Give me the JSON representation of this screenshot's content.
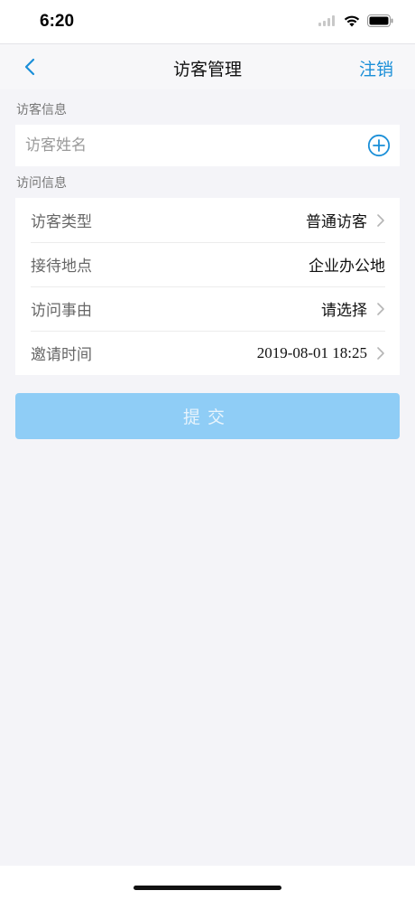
{
  "status_bar": {
    "time": "6:20"
  },
  "nav": {
    "title": "访客管理",
    "logout_label": "注销",
    "accent_color": "#1a8fd8"
  },
  "visitor_section": {
    "label": "访客信息",
    "name_placeholder": "访客姓名",
    "name_value": ""
  },
  "visit_section": {
    "label": "访问信息",
    "rows": [
      {
        "label": "访客类型",
        "value": "普通访客",
        "has_chevron": true
      },
      {
        "label": "接待地点",
        "value": "企业办公地",
        "has_chevron": false
      },
      {
        "label": "访问事由",
        "value": "请选择",
        "has_chevron": true
      },
      {
        "label": "邀请时间",
        "value": "2019-08-01 18:25",
        "has_chevron": true
      }
    ]
  },
  "submit": {
    "label": "提交",
    "color": "#8fcdf6"
  },
  "icons": {
    "back": "chevron-left-icon",
    "add": "plus-circle-icon",
    "row_arrow": "chevron-right-icon",
    "signal": "signal-icon",
    "wifi": "wifi-icon",
    "battery": "battery-icon"
  }
}
